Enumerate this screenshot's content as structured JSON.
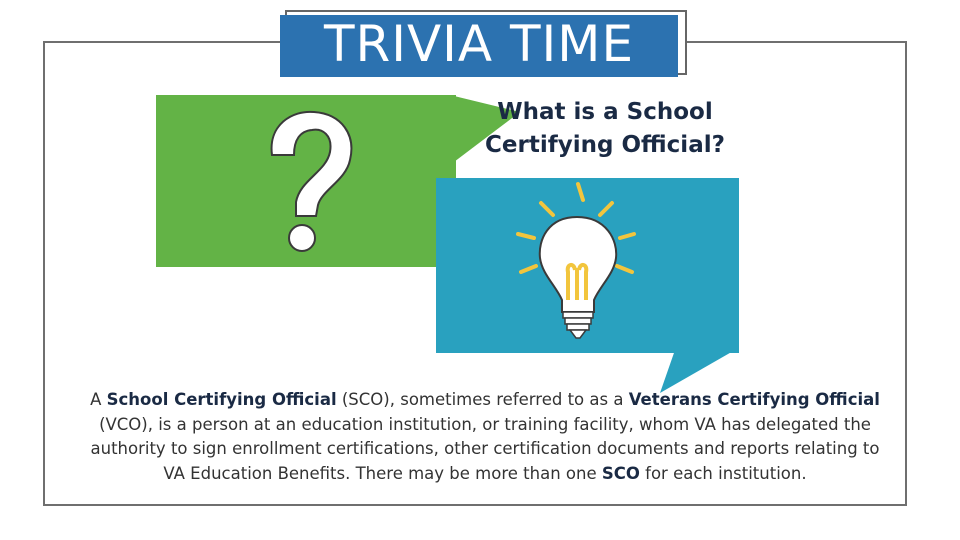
{
  "title": "TRIVIA TIME",
  "question": "What is a School Certifying Official?",
  "answer": {
    "sco_term": "School Certifying Official",
    "p1": " (SCO), sometimes referred  to as a ",
    "vco_term": "Veterans Certifying Official",
    "p2": " (VCO), is a person at an education institution, or training facility, whom VA has delegated the authority to sign enrollment certifications, other certification documents and reports relating to VA Education Benefits. There may be more than one ",
    "sco_abbr": "SCO",
    "p3": " for each institution.",
    "lead": "A "
  },
  "icons": [
    "question-mark-icon",
    "lightbulb-icon"
  ],
  "colors": {
    "title_bg": "#2c72b0",
    "green_bubble": "#63b346",
    "blue_bubble": "#29a1bf",
    "bulb_rays": "#f2c53d"
  }
}
